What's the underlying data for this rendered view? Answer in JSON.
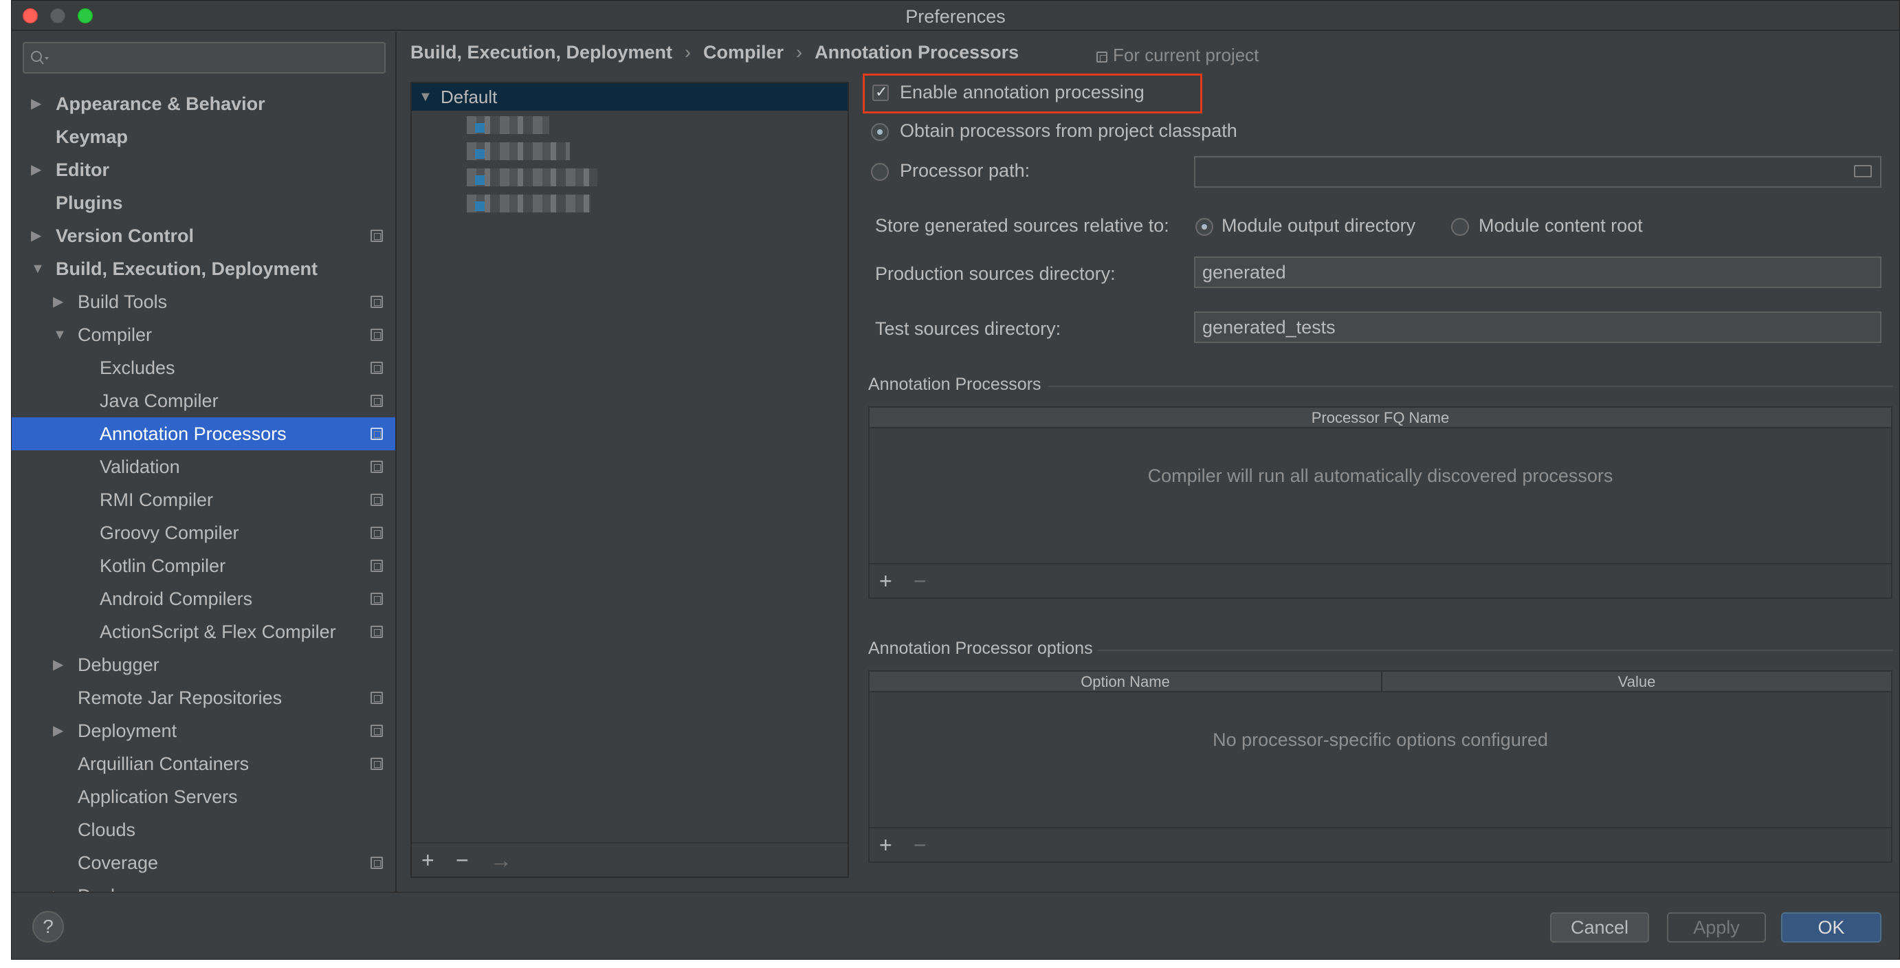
{
  "window": {
    "title": "Preferences"
  },
  "search": {
    "placeholder": ""
  },
  "sidebar": {
    "items": [
      {
        "label": "Appearance & Behavior",
        "arrow": "▶",
        "bold": true
      },
      {
        "label": "Keymap",
        "bold": true
      },
      {
        "label": "Editor",
        "arrow": "▶",
        "bold": true
      },
      {
        "label": "Plugins",
        "bold": true
      },
      {
        "label": "Version Control",
        "arrow": "▶",
        "bold": true
      },
      {
        "label": "Build, Execution, Deployment",
        "arrow": "▼",
        "bold": true
      },
      {
        "label": "Build Tools",
        "arrow": "▶"
      },
      {
        "label": "Compiler",
        "arrow": "▼"
      },
      {
        "label": "Excludes"
      },
      {
        "label": "Java Compiler"
      },
      {
        "label": "Annotation Processors",
        "selected": true
      },
      {
        "label": "Validation"
      },
      {
        "label": "RMI Compiler"
      },
      {
        "label": "Groovy Compiler"
      },
      {
        "label": "Kotlin Compiler"
      },
      {
        "label": "Android Compilers"
      },
      {
        "label": "ActionScript & Flex Compiler"
      },
      {
        "label": "Debugger",
        "arrow": "▶"
      },
      {
        "label": "Remote Jar Repositories"
      },
      {
        "label": "Deployment",
        "arrow": "▶"
      },
      {
        "label": "Arquillian Containers"
      },
      {
        "label": "Application Servers"
      },
      {
        "label": "Clouds"
      },
      {
        "label": "Coverage"
      },
      {
        "label": "Docker",
        "arrow": "▶"
      }
    ]
  },
  "breadcrumb": {
    "part1": "Build, Execution, Deployment",
    "sep": "›",
    "part2": "Compiler",
    "part3": "Annotation Processors",
    "scope": "For current project"
  },
  "profiles": {
    "default_label": "Default",
    "default_arrow": "▼",
    "add": "+",
    "remove": "−",
    "move": "→"
  },
  "settings": {
    "enable_label": "Enable annotation processing",
    "obtain_label": "Obtain processors from project classpath",
    "processor_path_label": "Processor path:",
    "processor_path_value": "",
    "store_label": "Store generated sources relative to:",
    "module_output_label": "Module output directory",
    "module_content_label": "Module content root",
    "production_label": "Production sources directory:",
    "production_value": "generated",
    "test_label": "Test sources directory:",
    "test_value": "generated_tests",
    "processors_section": "Annotation Processors",
    "processor_fq_header": "Processor FQ Name",
    "processors_empty": "Compiler will run all automatically discovered processors",
    "options_section": "Annotation Processor options",
    "option_name_header": "Option Name",
    "value_header": "Value",
    "options_empty": "No processor-specific options configured",
    "add": "+",
    "remove": "−"
  },
  "footer": {
    "help": "?",
    "cancel": "Cancel",
    "apply": "Apply",
    "ok": "OK"
  },
  "colors": {
    "accent_selection": "#2f65ca",
    "highlight_box": "#e03c1e",
    "primary_button": "#365880"
  }
}
